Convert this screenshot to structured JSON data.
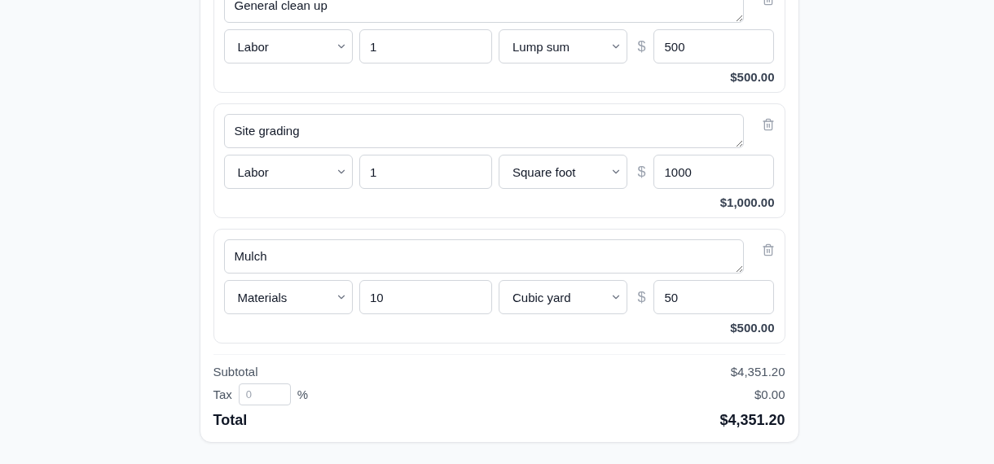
{
  "items": [
    {
      "description": "General clean up",
      "category": "Labor",
      "quantity": "1",
      "unit": "Lump sum",
      "currency": "$",
      "rate": "500",
      "amount": "$500.00"
    },
    {
      "description": "Site grading",
      "category": "Labor",
      "quantity": "1",
      "unit": "Square foot",
      "currency": "$",
      "rate": "1000",
      "amount": "$1,000.00"
    },
    {
      "description": "Mulch",
      "category": "Materials",
      "quantity": "10",
      "unit": "Cubic yard",
      "currency": "$",
      "rate": "50",
      "amount": "$500.00"
    }
  ],
  "summary": {
    "subtotal_label": "Subtotal",
    "subtotal": "$4,351.20",
    "tax_label": "Tax",
    "tax_placeholder": "0",
    "tax_unit": "%",
    "tax": "$0.00",
    "total_label": "Total",
    "total": "$4,351.20"
  }
}
